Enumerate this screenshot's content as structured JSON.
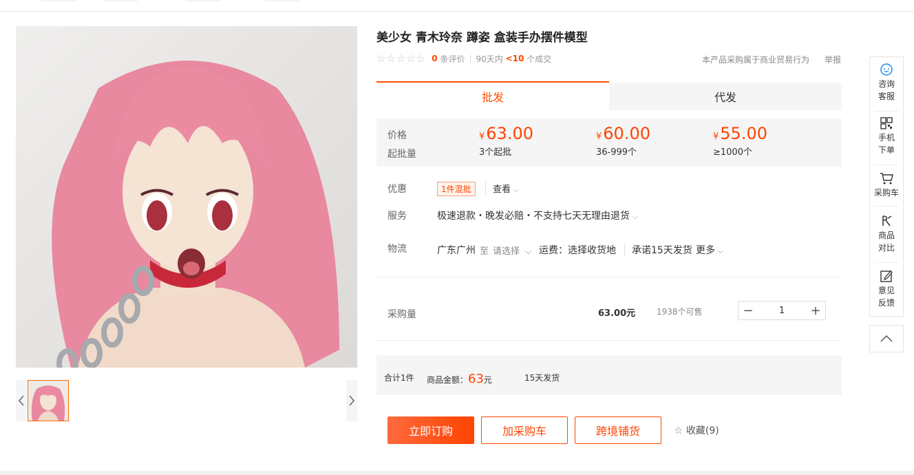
{
  "product": {
    "title": "美少女 青木玲奈 蹲姿 盒装手办摆件模型",
    "rating_stars": "☆☆☆☆☆",
    "review_count": "0",
    "review_label": "条评价",
    "period_label": "90天内",
    "sales_count": "<10",
    "sales_label": "个成交",
    "trade_note": "本产品采购属于商业贸易行为",
    "report_label": "举报"
  },
  "tabs": {
    "wholesale": "批发",
    "dropship": "代发"
  },
  "pricing": {
    "price_label": "价格",
    "moq_label": "起批量",
    "currency": "¥",
    "tiers": [
      {
        "price": "63.00",
        "qty": "3个起批"
      },
      {
        "price": "60.00",
        "qty": "36-999个"
      },
      {
        "price": "55.00",
        "qty": "≥1000个"
      }
    ]
  },
  "promo": {
    "label": "优惠",
    "tag": "1件混批",
    "view": "查看"
  },
  "service": {
    "label": "服务",
    "text": "极速退款・晚发必赔・不支持七天无理由退货"
  },
  "logistics": {
    "label": "物流",
    "from": "广东广州",
    "to_word": "至",
    "to_placeholder": "请选择",
    "shipping_fee": "运费：选择收货地",
    "promise": "承诺15天发货",
    "more": "更多"
  },
  "purchase": {
    "label": "采购量",
    "unit_price": "63.00元",
    "stock": "1938个可售",
    "quantity": "1",
    "minus": "−",
    "plus": "+"
  },
  "summary": {
    "total_items": "合计1件",
    "amount_label": "商品金额：",
    "amount": "63",
    "amount_unit": "元",
    "delivery": "15天发货"
  },
  "actions": {
    "buy_now": "立即订购",
    "add_cart": "加采购车",
    "cross_border": "跨境铺货",
    "favorite": "收藏(9)"
  },
  "sidebar": {
    "consult": [
      "咨询",
      "客服"
    ],
    "mobile": [
      "手机",
      "下单"
    ],
    "cart": "采购车",
    "compare": [
      "商品",
      "对比"
    ],
    "feedback": [
      "意见",
      "反馈"
    ]
  },
  "colors": {
    "accent": "#ff4400",
    "tab_active": "#ff5000",
    "panel_bg": "#f5f5f5"
  }
}
